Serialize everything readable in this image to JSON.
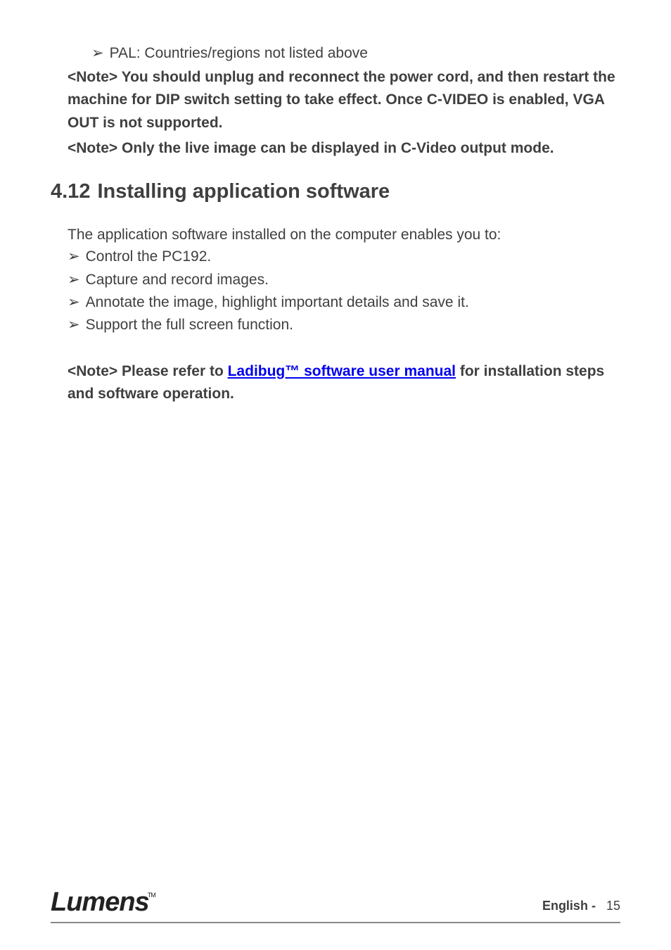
{
  "top_bullet": {
    "marker": "➢",
    "text": "PAL: Countries/regions not listed above"
  },
  "note1": "<Note> You should unplug and reconnect the power cord, and then restart the machine for DIP switch setting to take effect. Once C-VIDEO is enabled, VGA OUT is not supported.",
  "note2": "<Note> Only the live image can be displayed in C-Video output mode.",
  "section": {
    "number": "4.12",
    "title": "Installing application software"
  },
  "intro": "The application software installed on the computer enables you to:",
  "bullets": [
    {
      "marker": "➢",
      "text": "Control the PC192."
    },
    {
      "marker": "➢",
      "text": "Capture and record images."
    },
    {
      "marker": "➢",
      "text": "Annotate the image, highlight important details and save it."
    },
    {
      "marker": "➢",
      "text": "Support the full screen function."
    }
  ],
  "note3": {
    "prefix": "<Note> Please refer to ",
    "link": "Ladibug™ software user manual",
    "suffix": " for installation steps and software operation."
  },
  "footer": {
    "logo": "Lumens",
    "tm": "TM",
    "lang": "English -",
    "page": "15"
  }
}
